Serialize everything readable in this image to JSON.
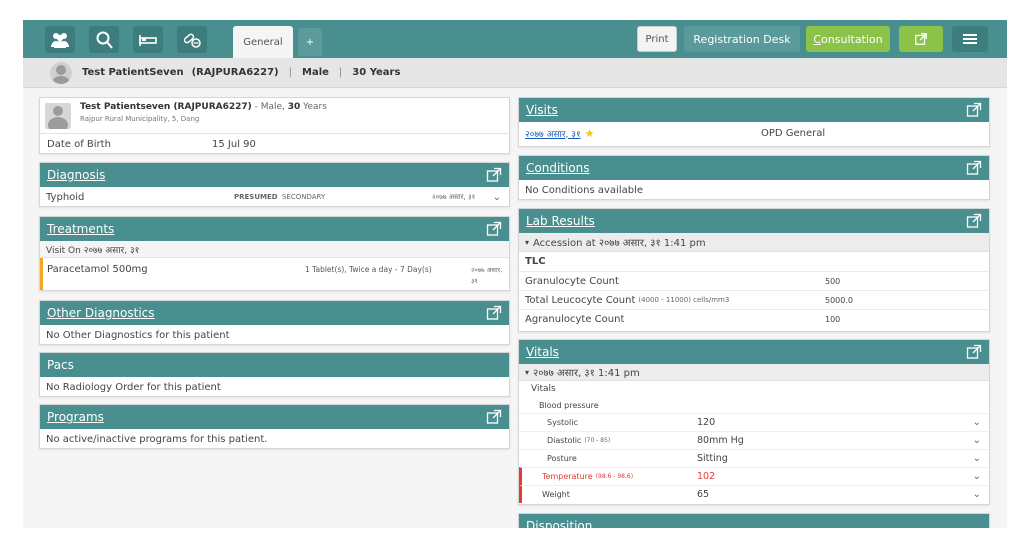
{
  "topbar": {
    "icons": [
      "patients-icon",
      "search-icon",
      "bed-icon",
      "pills-icon"
    ],
    "tab_general": "General",
    "tab_add": "+",
    "print": "Print",
    "registration_desk": "Registration Desk",
    "consultation_first": "C",
    "consultation_rest": "onsultation"
  },
  "patient_strip": {
    "name": "Test PatientSeven",
    "id": "(RAJPURA6227)",
    "gender": "Male",
    "age": "30 Years"
  },
  "patient_card": {
    "name": "Test Patientseven (RAJPURA6227)",
    "summary_prefix": " - Male, ",
    "summary_age": "30",
    "summary_suffix": " Years",
    "address": "Rajpur Rural Municipality, 5, Dang",
    "dob_label": "Date of Birth",
    "dob_value": "15 Jul 90"
  },
  "diagnosis": {
    "title": "Diagnosis",
    "name": "Typhoid",
    "certainty": "PRESUMED",
    "order": "SECONDARY",
    "date": "२०७७ असार, ३१"
  },
  "treatments": {
    "title": "Treatments",
    "visit_label": "Visit On २०७७ असार, ३१",
    "drug": "Paracetamol 500mg",
    "dosage": "1 Tablet(s), Twice a day - 7 Day(s)",
    "date_line1": "२०७७ असार,",
    "date_line2": "३१"
  },
  "other_diagnostics": {
    "title": "Other Diagnostics",
    "message": "No Other Diagnostics for this patient"
  },
  "pacs": {
    "title": "Pacs",
    "message": "No Radiology Order for this patient"
  },
  "programs": {
    "title": "Programs",
    "message": "No active/inactive programs for this patient."
  },
  "visits": {
    "title": "Visits",
    "date": "२०७७ असार, ३१",
    "type": "OPD General"
  },
  "conditions": {
    "title": "Conditions",
    "message": "No Conditions available"
  },
  "lab_results": {
    "title": "Lab Results",
    "accession": "Accession at २०७७ असार, ३१ 1:41 pm",
    "group": "TLC",
    "rows": [
      {
        "label": "Granulocyte Count",
        "range": "",
        "value": "500"
      },
      {
        "label": "Total Leucocyte Count",
        "range": "(4000 - 11000) cells/mm3",
        "value": "5000.0"
      },
      {
        "label": "Agranulocyte Count",
        "range": "",
        "value": "100"
      }
    ]
  },
  "vitals": {
    "title": "Vitals",
    "date": "२०७७ असार, ३१ 1:41 pm",
    "group": "Vitals",
    "bp_label": "Blood pressure",
    "rows": [
      {
        "label": "Systolic",
        "range": "",
        "value": "120",
        "abnormal": false
      },
      {
        "label": "Diastolic",
        "range": "(70 - 85)",
        "value": "80mm Hg",
        "abnormal": false
      },
      {
        "label": "Posture",
        "range": "",
        "value": "Sitting",
        "abnormal": false
      },
      {
        "label": "Temperature",
        "range": "(98.6 - 98.6)",
        "value": "102",
        "abnormal": true
      },
      {
        "label": "Weight",
        "range": "",
        "value": "65",
        "abnormal": false
      }
    ]
  },
  "disposition": {
    "title": "Disposition"
  },
  "colors": {
    "header_teal": "#4a8f8f",
    "accent_green": "#8bc34a",
    "abnormal_red": "#e53935",
    "treatment_marker": "#f5a623",
    "star": "#f5c518"
  }
}
